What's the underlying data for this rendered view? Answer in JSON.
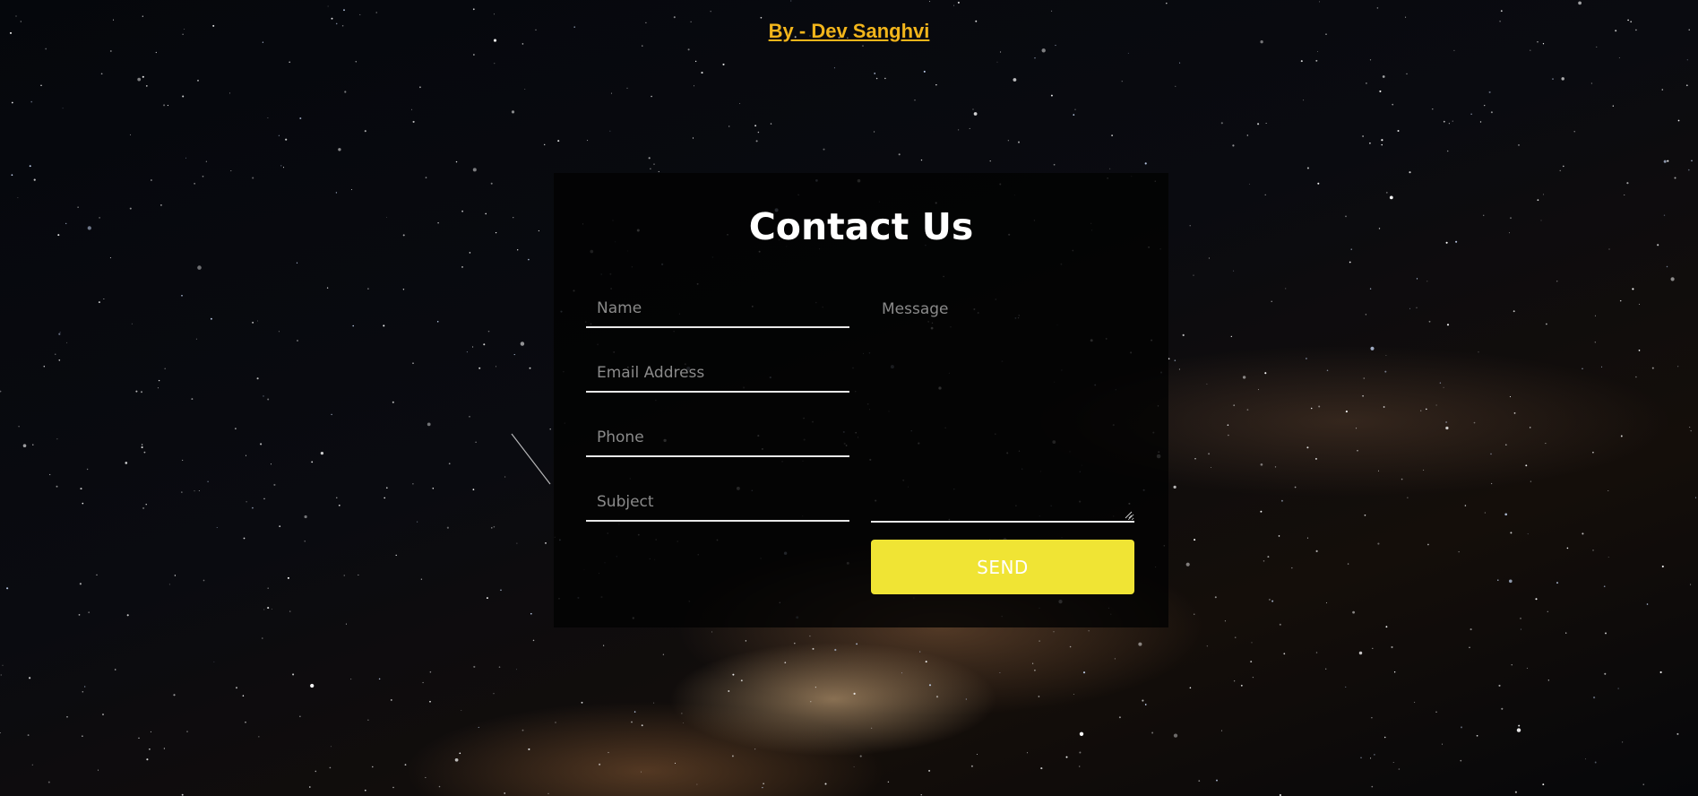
{
  "header": {
    "credit_link": "By - Dev Sanghvi"
  },
  "contact_form": {
    "title": "Contact Us",
    "fields": {
      "name_placeholder": "Name",
      "email_placeholder": "Email Address",
      "phone_placeholder": "Phone",
      "subject_placeholder": "Subject",
      "message_placeholder": "Message"
    },
    "send_label": "SEND"
  },
  "colors": {
    "accent_link": "#f2b51b",
    "send_button": "#f0e434",
    "card_background": "#030303",
    "field_underline": "#e8e8e8"
  },
  "icons": {
    "resize_handle": "textarea-resize-grip-icon"
  }
}
